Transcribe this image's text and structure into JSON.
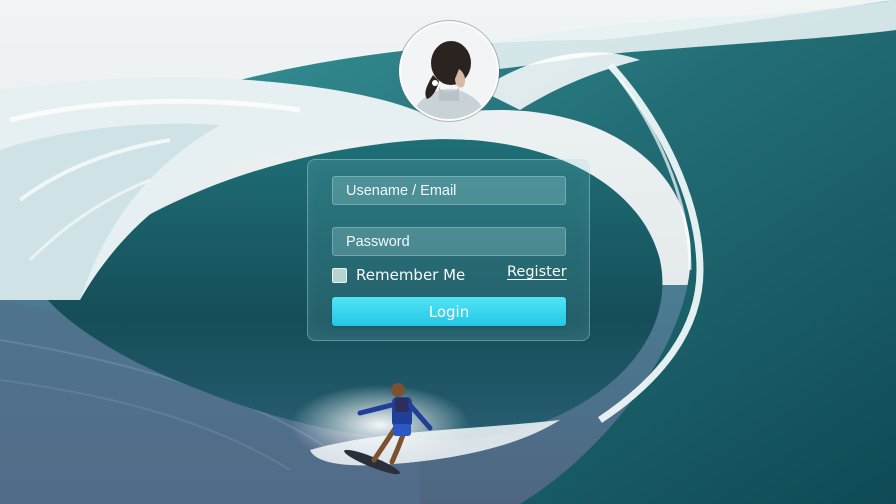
{
  "login_form": {
    "username_placeholder": "Usename / Email",
    "password_placeholder": "Password",
    "remember_label": "Remember Me",
    "register_label": "Register",
    "login_label": "Login",
    "remember_checked": false
  },
  "icons": {
    "avatar": "user-avatar-image"
  },
  "colors": {
    "button": "#2dd0ea",
    "panel_tint": "#78c8cd",
    "wave": "#2f8f95"
  }
}
